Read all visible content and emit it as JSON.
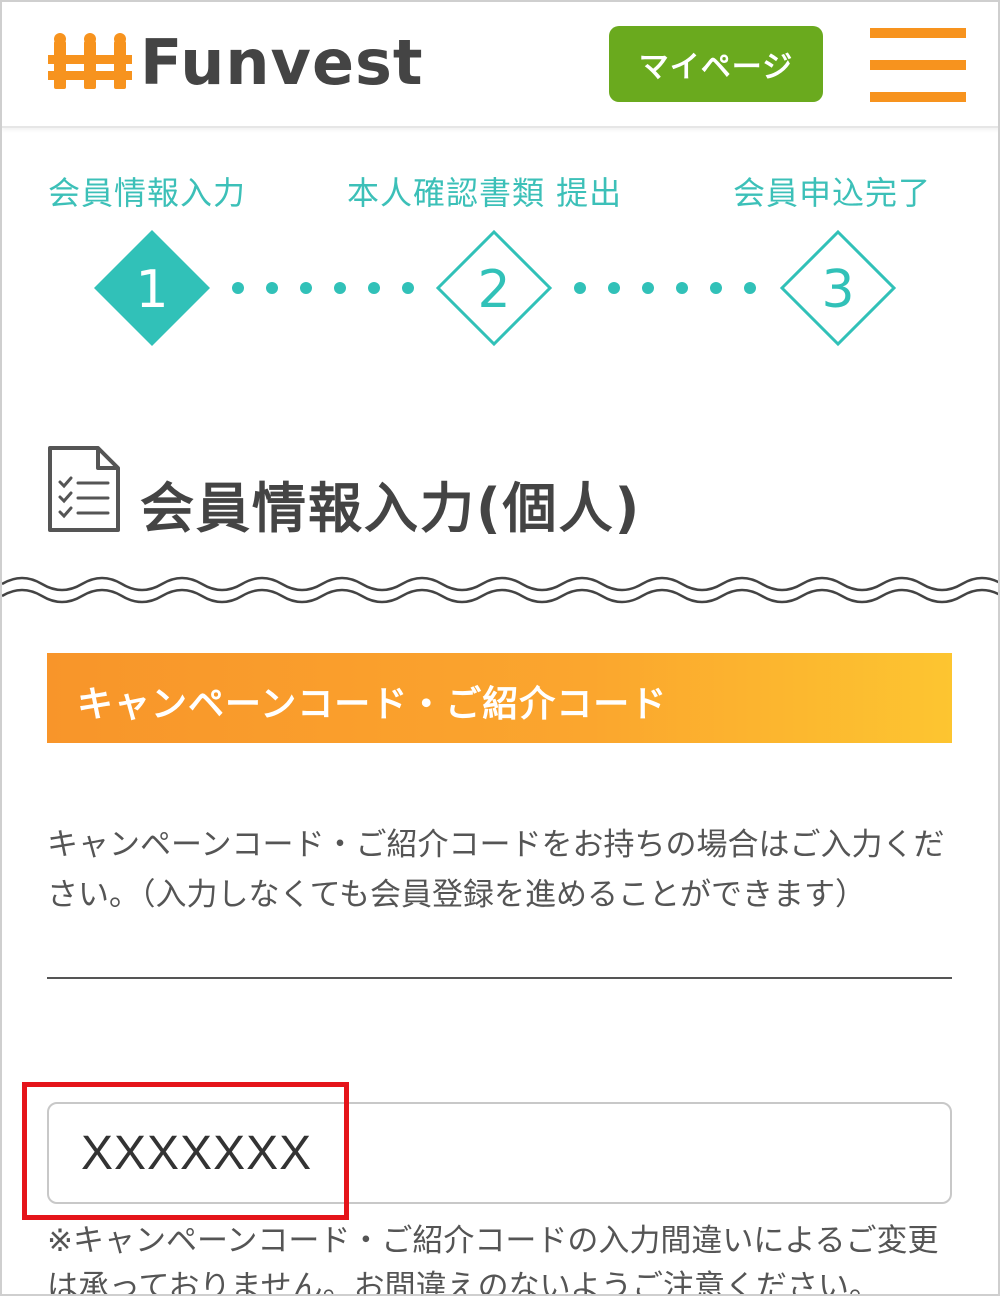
{
  "header": {
    "logo_text": "Funvest",
    "mypage_label": "マイページ",
    "menu_icon": "hamburger-icon",
    "colors": {
      "brand_orange": "#f7931e",
      "mypage_green": "#6aaa1e"
    }
  },
  "steps": {
    "items": [
      {
        "label": "会員情報入力",
        "number": "1",
        "active": true
      },
      {
        "label": "本人確認書類 提出",
        "number": "2",
        "active": false
      },
      {
        "label": "会員申込完了",
        "number": "3",
        "active": false
      }
    ],
    "color": "#3cc0b8"
  },
  "page": {
    "title": "会員情報入力(個人)",
    "title_icon": "checklist-document-icon"
  },
  "section": {
    "title": "キャンペーンコード・ご紹介コード",
    "description": "キャンペーンコード・ご紹介コードをお持ちの場合はご入力ください。（入力しなくても会員登録を進めることができます）",
    "code_input": {
      "value": "XXXXXXX",
      "placeholder": ""
    },
    "note": "※キャンペーンコード・ご紹介コードの入力間違いによるご変更は承っておりません。お間違えのないようご注意ください。",
    "highlight_color": "#e5141a"
  }
}
